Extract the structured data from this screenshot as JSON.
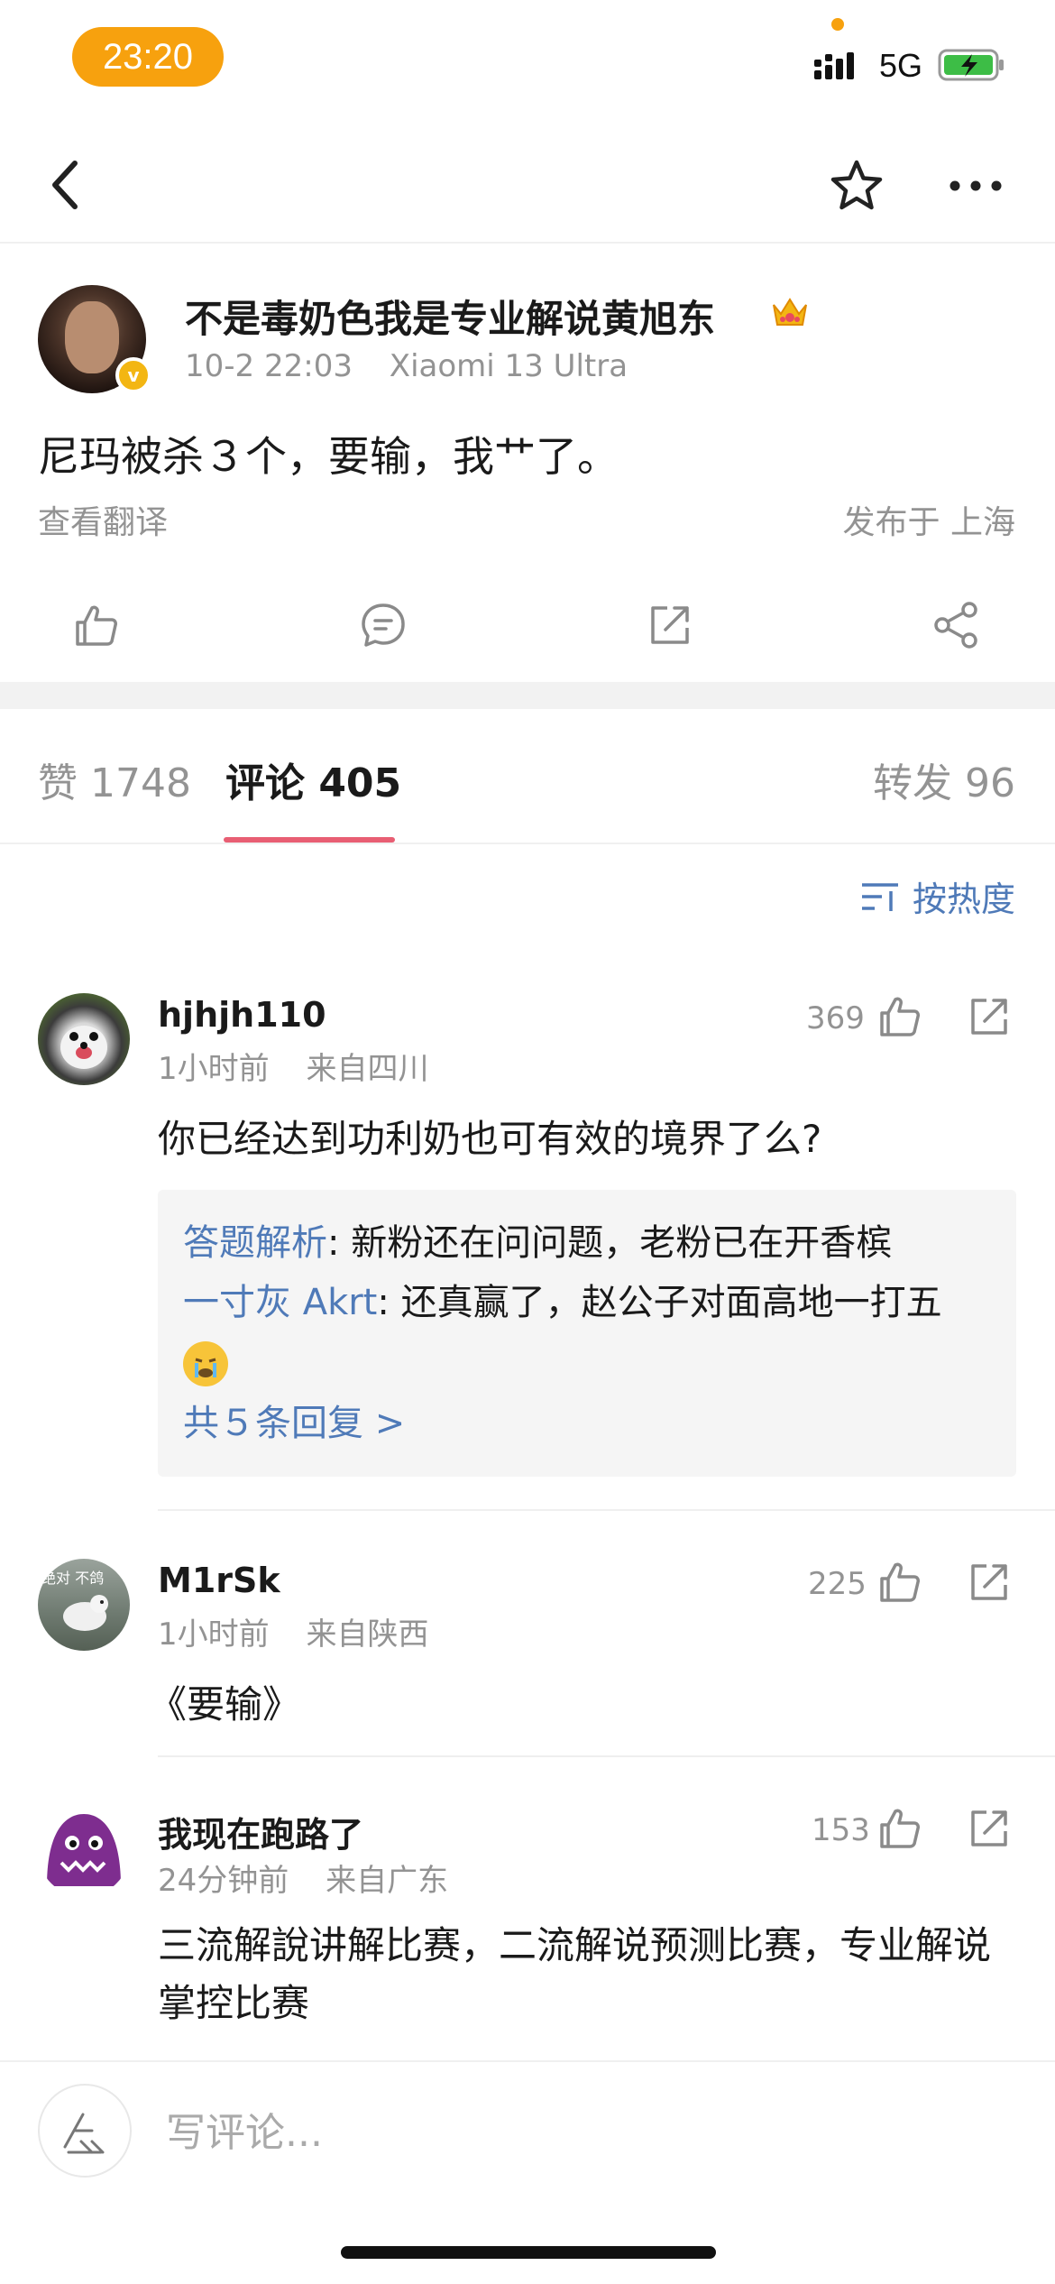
{
  "status_bar": {
    "time": "23:20",
    "network": "5G"
  },
  "post": {
    "author": "不是毒奶色我是专业解说黄旭东",
    "date": "10-2 22:03",
    "device": "Xiaomi 13 Ultra",
    "text": "尼玛被杀３个，要输，我艹了。",
    "translate": "查看翻译",
    "location": "发布于 上海"
  },
  "tabs": [
    {
      "label": "赞 1748"
    },
    {
      "label": "评论 405"
    },
    {
      "label": "转发 96"
    }
  ],
  "sort": {
    "label": "按热度"
  },
  "comments": [
    {
      "name": "hjhjh110",
      "time": "1小时前",
      "origin": "来自四川",
      "likes": "369",
      "text": "你已经达到功利奶也可有效的境界了么?",
      "replies": [
        {
          "user": "答题解析",
          "text": ": 新粉还在问问题，老粉已在开香槟"
        },
        {
          "user": "一寸灰 Akrt",
          "text": ": 还真赢了，赵公子对面高地一打五"
        }
      ],
      "reply_more": "共５条回复 >"
    },
    {
      "name": "M1rSk",
      "time": "1小时前",
      "origin": "来自陕西",
      "likes": "225",
      "avatar_text": "绝对 不鸽",
      "text": "《要输》"
    },
    {
      "name": "我现在跑路了",
      "time": "24分钟前",
      "origin": "来自广东",
      "likes": "153",
      "text": "三流解說讲解比赛，二流解说预测比赛，专业解说掌控比赛"
    }
  ],
  "input": {
    "placeholder": "写评论..."
  },
  "colors": {
    "accent": "#e85e73",
    "link": "#4f7ab8",
    "status_pill": "#f7a10e",
    "verified": "#f3b613"
  }
}
